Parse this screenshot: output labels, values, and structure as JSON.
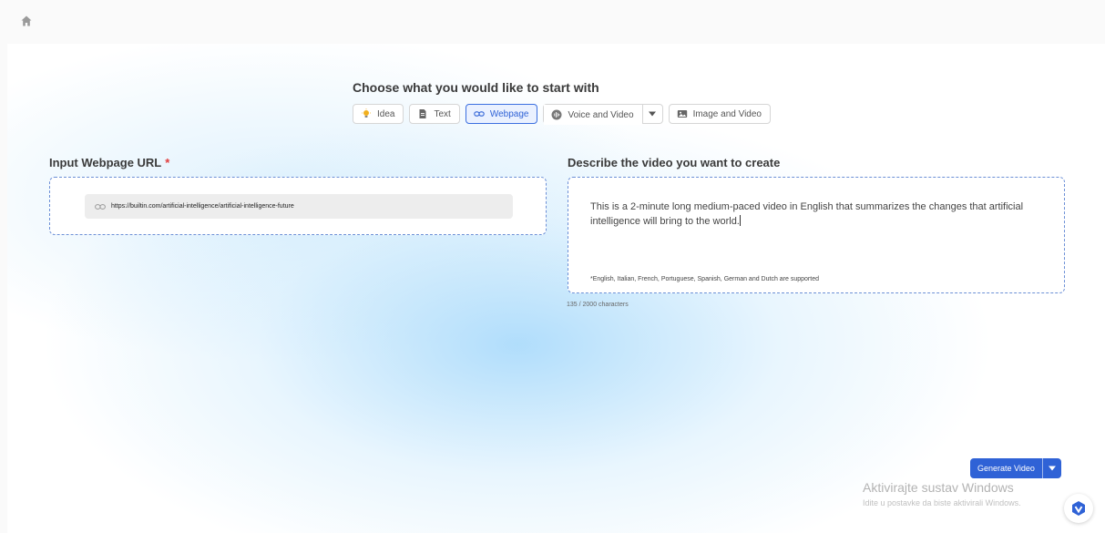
{
  "header": {
    "home_icon": "home-icon"
  },
  "chooser": {
    "title": "Choose what you would like to start with",
    "tabs": [
      {
        "label": "Idea",
        "icon": "lightbulb-icon",
        "active": false
      },
      {
        "label": "Text",
        "icon": "document-icon",
        "active": false
      },
      {
        "label": "Webpage",
        "icon": "link-icon",
        "active": true
      },
      {
        "label": "Voice and Video",
        "icon": "microphone-icon",
        "active": false,
        "has_dropdown": true
      },
      {
        "label": "Image and Video",
        "icon": "image-icon",
        "active": false
      }
    ]
  },
  "webpage_input": {
    "label": "Input Webpage URL",
    "required_mark": "*",
    "value": "https://builtin.com/artificial-intelligence/artificial-intelligence-future"
  },
  "description": {
    "label": "Describe the video you want to create",
    "value": "This is a 2-minute long medium-paced video in English that summarizes the changes that artificial intelligence will bring to the world.",
    "supported_note": "*English, Italian, French, Portuguese, Spanish, German and Dutch are supported",
    "char_count": "135 / 2000 characters"
  },
  "actions": {
    "generate_label": "Generate Video"
  },
  "watermark": {
    "title": "Aktivirajte sustav Windows",
    "subtitle": "Idite u postavke da biste aktivirali Windows."
  },
  "colors": {
    "accent": "#2f62d6",
    "required": "#e23d3d",
    "border_dashed": "#6b8fd6"
  }
}
